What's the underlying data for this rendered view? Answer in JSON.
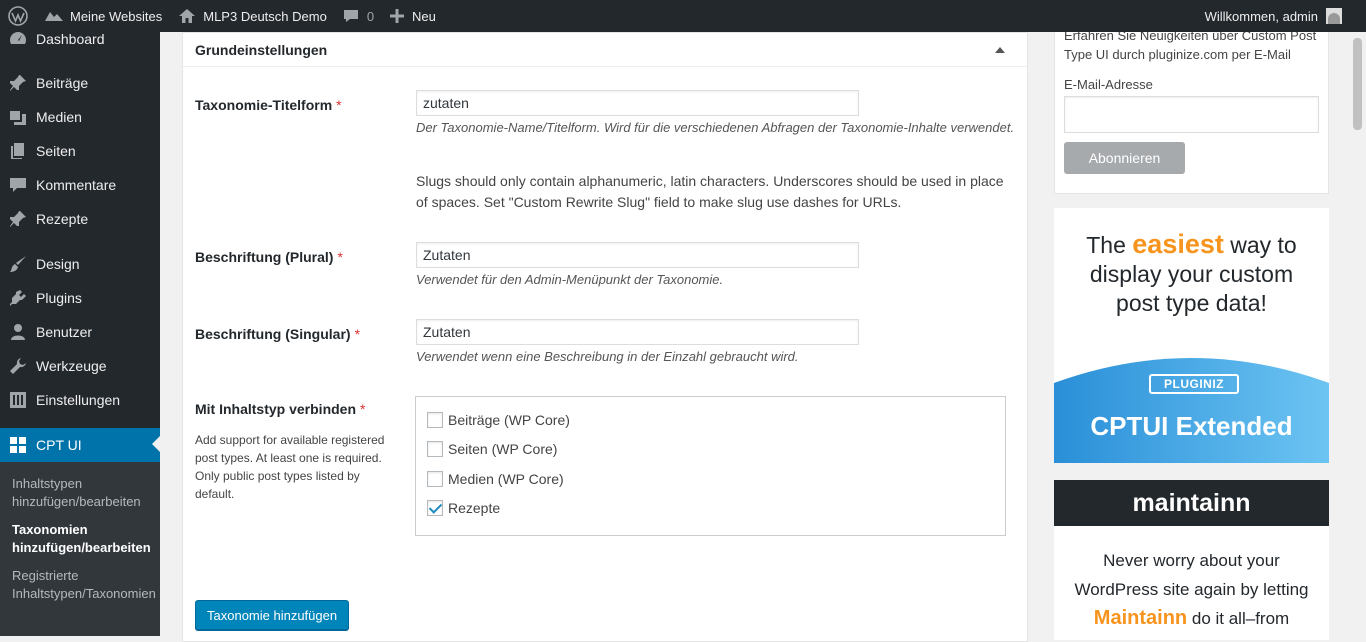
{
  "adminbar": {
    "sites": "Meine Websites",
    "site_name": "MLP3 Deutsch Demo",
    "comments_count": "0",
    "new": "Neu",
    "welcome": "Willkommen, admin"
  },
  "sidebar": {
    "items": [
      {
        "label": "Dashboard",
        "icon": "dashboard-icon"
      },
      {
        "label": "Beiträge",
        "icon": "pin-icon"
      },
      {
        "label": "Medien",
        "icon": "media-icon"
      },
      {
        "label": "Seiten",
        "icon": "page-icon"
      },
      {
        "label": "Kommentare",
        "icon": "comment-icon"
      },
      {
        "label": "Rezepte",
        "icon": "pin-icon"
      },
      {
        "label": "Design",
        "icon": "brush-icon"
      },
      {
        "label": "Plugins",
        "icon": "plugin-icon"
      },
      {
        "label": "Benutzer",
        "icon": "user-icon"
      },
      {
        "label": "Werkzeuge",
        "icon": "wrench-icon"
      },
      {
        "label": "Einstellungen",
        "icon": "settings-icon"
      },
      {
        "label": "CPT UI",
        "icon": "grid-icon"
      }
    ],
    "submenu": [
      "Inhaltstypen hinzufügen/bearbeiten",
      "Taxonomien hinzufügen/bearbeiten",
      "Registrierte Inhaltstypen/Taxonomien"
    ]
  },
  "panel": {
    "title": "Grundeinstellungen",
    "fields": {
      "name_label": "Taxonomie-Titelform",
      "name_value": "zutaten",
      "name_help": "Der Taxonomie-Name/Titelform. Wird für die verschiedenen Abfragen der Taxonomie-Inhalte verwendet.",
      "name_note": "Slugs should only contain alphanumeric, latin characters. Underscores should be used in place of spaces. Set \"Custom Rewrite Slug\" field to make slug use dashes for URLs.",
      "plural_label": "Beschriftung (Plural)",
      "plural_value": "Zutaten",
      "plural_help": "Verwendet für den Admin-Menüpunkt der Taxonomie.",
      "singular_label": "Beschriftung (Singular)",
      "singular_value": "Zutaten",
      "singular_help": "Verwendet wenn eine Beschreibung in der Einzahl gebraucht wird.",
      "posttypes_label": "Mit Inhaltstyp verbinden",
      "posttypes_desc": "Add support for available registered post types. At least one is required. Only public post types listed by default.",
      "required_mark": "*"
    },
    "checkboxes": [
      {
        "label": "Beiträge (WP Core)",
        "checked": false
      },
      {
        "label": "Seiten (WP Core)",
        "checked": false
      },
      {
        "label": "Medien (WP Core)",
        "checked": false
      },
      {
        "label": "Rezepte",
        "checked": true
      }
    ],
    "submit": "Taxonomie hinzufügen"
  },
  "newsletter": {
    "text": "Erfahren Sie Neuigkeiten über Custom Post Type UI durch pluginize.com per E-Mail",
    "email_label": "E-Mail-Adresse",
    "button": "Abonnieren"
  },
  "ad_cptui": {
    "line1_pre": "The",
    "line1_highlight": "easiest",
    "line1_post": "way to",
    "line2": "display your custom",
    "line3": "post type data!",
    "logo": "PLUGINIZ",
    "title": "CPTUI Extended"
  },
  "ad_maintainn": {
    "brand": "maintainn",
    "line1": "Never worry about your",
    "line2": "WordPress site again by letting",
    "highlight": "Maintainn",
    "line3_post": "do it all–from"
  },
  "colors": {
    "adminbar": "#23282d",
    "accent": "#0073aa",
    "button": "#0085ba",
    "orange": "#f7941d"
  }
}
